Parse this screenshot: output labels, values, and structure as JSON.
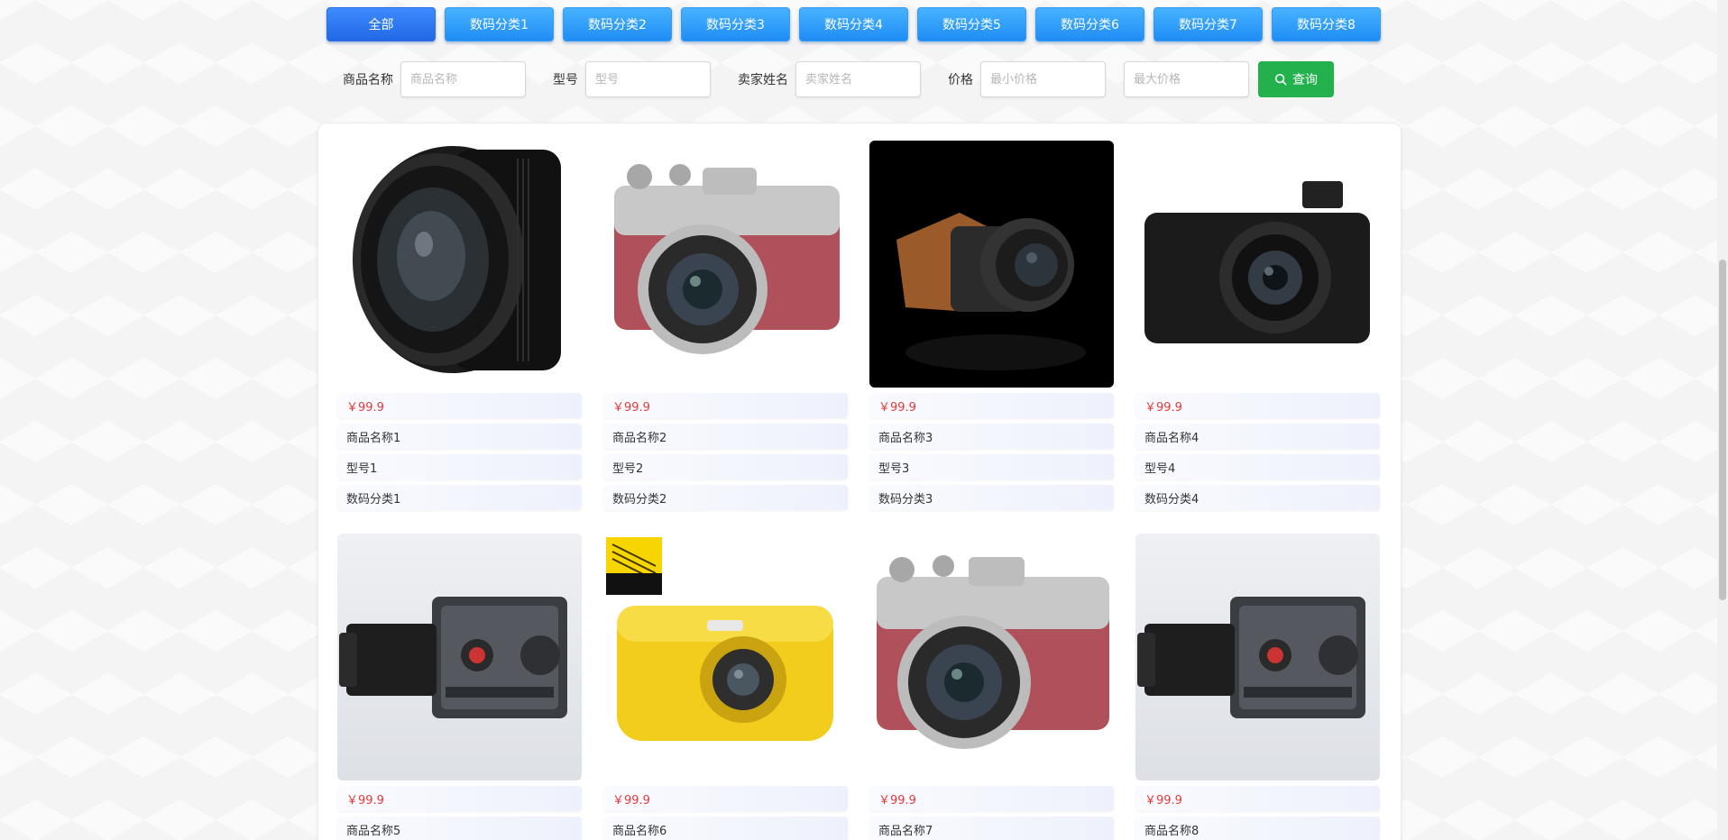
{
  "tabs": [
    "全部",
    "数码分类1",
    "数码分类2",
    "数码分类3",
    "数码分类4",
    "数码分类5",
    "数码分类6",
    "数码分类7",
    "数码分类8"
  ],
  "search": {
    "name_label": "商品名称",
    "name_placeholder": "商品名称",
    "model_label": "型号",
    "model_placeholder": "型号",
    "seller_label": "卖家姓名",
    "seller_placeholder": "卖家姓名",
    "price_label": "价格",
    "min_placeholder": "最小价格",
    "max_placeholder": "最大价格",
    "query_label": "查询"
  },
  "products": [
    {
      "price": "￥99.9",
      "name": "商品名称1",
      "model": "型号1",
      "category": "数码分类1",
      "image": "camera-lens"
    },
    {
      "price": "￥99.9",
      "name": "商品名称2",
      "model": "型号2",
      "category": "数码分类2",
      "image": "mirrorless-camera-red"
    },
    {
      "price": "￥99.9",
      "name": "商品名称3",
      "model": "型号3",
      "category": "数码分类3",
      "image": "camera-on-black"
    },
    {
      "price": "￥99.9",
      "name": "商品名称4",
      "model": "型号4",
      "category": "数码分类4",
      "image": "compact-camera-black"
    },
    {
      "price": "￥99.9",
      "name": "商品名称5",
      "image": "medium-format-camera"
    },
    {
      "price": "￥99.9",
      "name": "商品名称6",
      "image": "yellow-compact-camera"
    },
    {
      "price": "￥99.9",
      "name": "商品名称7",
      "image": "mirrorless-camera-red"
    },
    {
      "price": "￥99.9",
      "name": "商品名称8",
      "image": "medium-format-camera"
    }
  ],
  "colors": {
    "tab": "#1f8cf5",
    "tab_active": "#2268e6",
    "query": "#22b14c",
    "price": "#e23a3a"
  }
}
